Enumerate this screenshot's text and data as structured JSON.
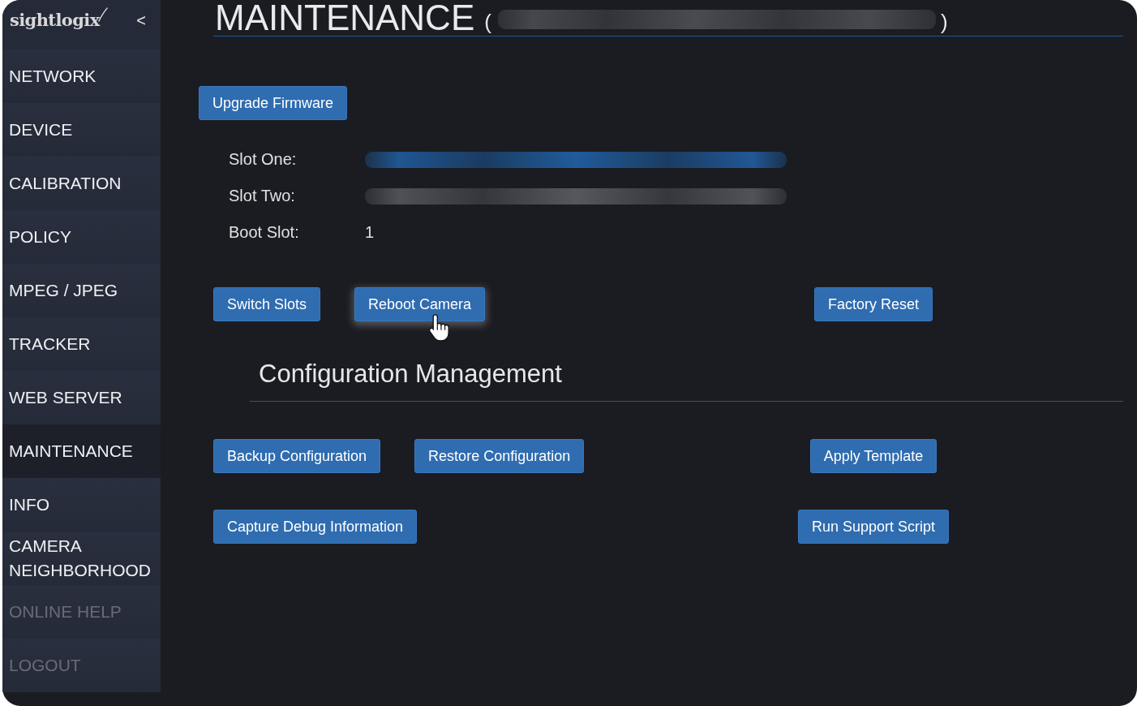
{
  "sidebar": {
    "logo": "sightlogix",
    "collapse": "<",
    "items": [
      {
        "label": "NETWORK",
        "selected": false,
        "disabled": false
      },
      {
        "label": "DEVICE",
        "selected": false,
        "disabled": false
      },
      {
        "label": "CALIBRATION",
        "selected": false,
        "disabled": false
      },
      {
        "label": "POLICY",
        "selected": false,
        "disabled": false
      },
      {
        "label": "MPEG / JPEG",
        "selected": false,
        "disabled": false
      },
      {
        "label": "TRACKER",
        "selected": false,
        "disabled": false
      },
      {
        "label": "WEB SERVER",
        "selected": false,
        "disabled": false
      },
      {
        "label": "MAINTENANCE",
        "selected": true,
        "disabled": false
      },
      {
        "label": "INFO",
        "selected": false,
        "disabled": false
      },
      {
        "label": "CAMERA NEIGHBORHOOD",
        "selected": false,
        "disabled": false
      },
      {
        "label": "ONLINE HELP",
        "selected": false,
        "disabled": true
      },
      {
        "label": "LOGOUT",
        "selected": false,
        "disabled": true
      }
    ]
  },
  "header": {
    "title": "MAINTENANCE",
    "open_paren": "(",
    "device_redacted": true,
    "close_paren": ")"
  },
  "firmware": {
    "upgrade_button": "Upgrade Firmware",
    "slots": [
      {
        "label": "Slot One:",
        "redacted": true,
        "active": true
      },
      {
        "label": "Slot Two:",
        "redacted": true,
        "active": false
      },
      {
        "label": "Boot Slot:",
        "redacted": false,
        "value": "1"
      }
    ],
    "rows": [
      {
        "left": [
          {
            "label": "Switch Slots",
            "hovered": false
          },
          {
            "label": "Reboot Camera",
            "hovered": true
          }
        ],
        "right": [
          {
            "label": "Factory Reset",
            "hovered": false
          }
        ]
      }
    ]
  },
  "configuration": {
    "title": "Configuration Management",
    "rows": [
      {
        "left": [
          {
            "label": "Backup Configuration",
            "hovered": false
          },
          {
            "label": "Restore Configuration",
            "hovered": false
          }
        ],
        "right": [
          {
            "label": "Apply Template",
            "hovered": false
          }
        ]
      },
      {
        "left": [
          {
            "label": "Capture Debug Information",
            "hovered": false
          }
        ],
        "right": [
          {
            "label": "Run Support Script",
            "hovered": false
          }
        ]
      }
    ]
  }
}
